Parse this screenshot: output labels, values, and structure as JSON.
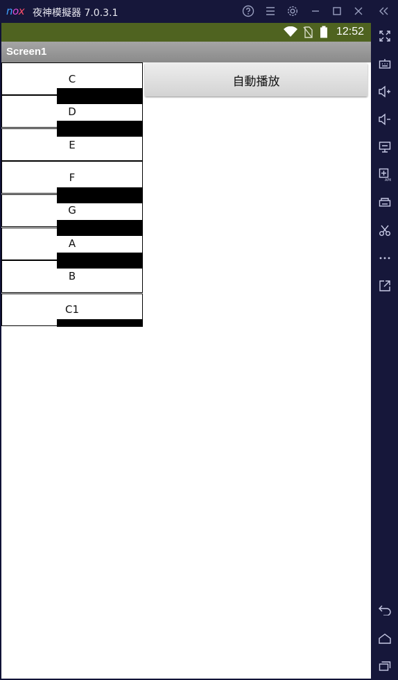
{
  "emulator": {
    "logo": {
      "n": "n",
      "o": "o",
      "x": "x"
    },
    "title": "夜神模擬器 7.0.3.1",
    "titlebar_icons": [
      "help-icon",
      "menu-icon",
      "settings-icon",
      "minimize-icon",
      "maximize-icon",
      "close-icon",
      "collapse-icon"
    ],
    "side_icons": [
      "fullscreen-icon",
      "keyboard-icon",
      "volume-up-icon",
      "volume-down-icon",
      "screen-icon",
      "add-apk-icon",
      "printer-icon",
      "scissors-icon",
      "more-icon",
      "open-external-icon",
      "back-icon",
      "home-icon",
      "recents-icon"
    ]
  },
  "statusbar": {
    "time": "12:52",
    "icons": [
      "wifi-icon",
      "no-sim-icon",
      "battery-icon"
    ]
  },
  "app": {
    "screen_title": "Screen1",
    "auto_play_label": "自動播放",
    "white_keys": [
      {
        "label": "C"
      },
      {
        "label": "D"
      },
      {
        "label": "E"
      },
      {
        "label": "F"
      },
      {
        "label": "G"
      },
      {
        "label": "A"
      },
      {
        "label": "B"
      },
      {
        "label": "C1"
      }
    ],
    "black_keys": [
      "C#",
      "D#",
      "F#",
      "G#",
      "A#",
      "C1#"
    ]
  },
  "colors": {
    "statusbar": "#4f6320",
    "appbar": "#999999",
    "emulator_frame": "#16173a"
  }
}
